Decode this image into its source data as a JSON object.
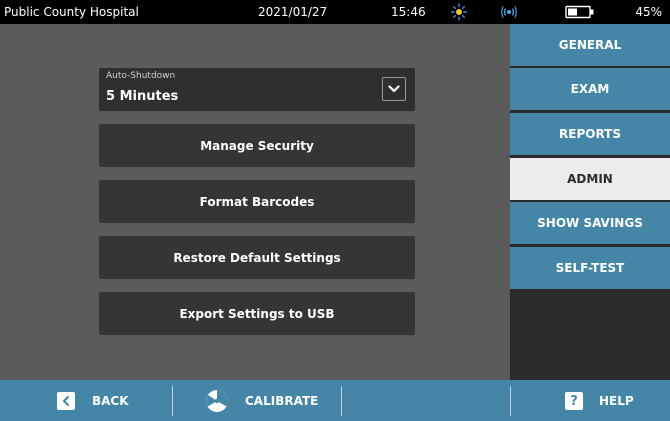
{
  "status": {
    "facility": "Public County Hospital",
    "date": "2021/01/27",
    "time": "15:46",
    "battery_pct": "45%",
    "icons": [
      "sun-icon",
      "wireless-icon",
      "battery-icon"
    ]
  },
  "settings": {
    "auto_shutdown": {
      "label": "Auto-Shutdown",
      "value": "5 Minutes"
    },
    "buttons": [
      {
        "label": "Manage Security"
      },
      {
        "label": "Format Barcodes"
      },
      {
        "label": "Restore Default Settings"
      },
      {
        "label": "Export Settings to USB"
      }
    ]
  },
  "nav": {
    "items": [
      {
        "label": "GENERAL",
        "active": false
      },
      {
        "label": "EXAM",
        "active": false
      },
      {
        "label": "REPORTS",
        "active": false
      },
      {
        "label": "ADMIN",
        "active": true
      },
      {
        "label": "SHOW SAVINGS",
        "active": false
      },
      {
        "label": "SELF-TEST",
        "active": false
      }
    ]
  },
  "bottom": {
    "back": "BACK",
    "calibrate": "CALIBRATE",
    "help": "HELP",
    "help_glyph": "?"
  },
  "colors": {
    "accent_blue": "#4586a6",
    "panel_gray": "#5b5b5b",
    "button_dark": "#353535",
    "active_tab": "#ececec"
  }
}
